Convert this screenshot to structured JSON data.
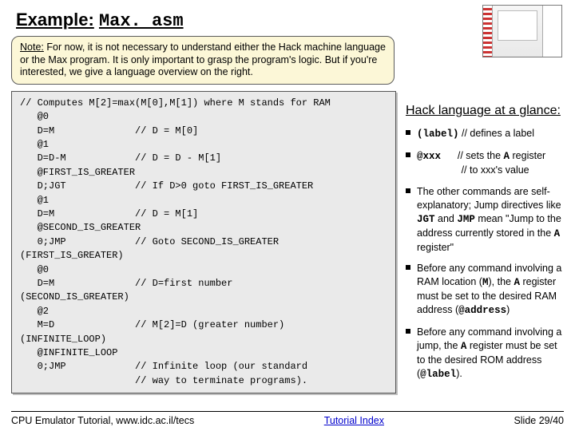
{
  "title": {
    "prefix": "Example:",
    "file": "Max. asm"
  },
  "note": {
    "label": "Note:",
    "body": "For now, it is not necessary to understand either the Hack machine language or the Max program. It is only important to grasp the program's logic.  But if you're interested, we give a language overview on the right."
  },
  "code": "// Computes M[2]=max(M[0],M[1]) where M stands for RAM\n   @0\n   D=M              // D = M[0]\n   @1\n   D=D-M            // D = D - M[1]\n   @FIRST_IS_GREATER\n   D;JGT            // If D>0 goto FIRST_IS_GREATER\n   @1\n   D=M              // D = M[1]\n   @SECOND_IS_GREATER\n   0;JMP            // Goto SECOND_IS_GREATER\n(FIRST_IS_GREATER)\n   @0\n   D=M              // D=first number\n(SECOND_IS_GREATER)\n   @2\n   M=D              // M[2]=D (greater number)\n(INFINITE_LOOP)\n   @INFINITE_LOOP\n   0;JMP            // Infinite loop (our standard\n                    // way to terminate programs).",
  "glance": {
    "heading": "Hack language at a glance:",
    "b1_code": "(label)",
    "b1_rest": " // defines a label",
    "b2_code": "@xxx",
    "b2_a": " // sets the ",
    "b2_b": " register",
    "b2_c": "// to xxx's value",
    "b3_a": "The other commands are self-explanatory; Jump directives like ",
    "b3_j1": "JGT",
    "b3_mid": " and ",
    "b3_j2": "JMP",
    "b3_b": " mean \"Jump to the address currently stored in the ",
    "b3_c": " register\"",
    "b4_a": "Before any command involving a RAM location (",
    "b4_m": "M",
    "b4_b": "), the ",
    "b4_c": " register must be set to the desired RAM address (",
    "b4_addr": "@address",
    "b4_d": ")",
    "b5_a": "Before any command involving a jump, the ",
    "b5_b": " register must be set to the desired ROM address (",
    "b5_lbl": "@label",
    "b5_c": ").",
    "A": "A"
  },
  "footer": {
    "left": "CPU Emulator Tutorial, www.idc.ac.il/tecs",
    "center": "Tutorial Index",
    "right": "Slide 29/40"
  }
}
